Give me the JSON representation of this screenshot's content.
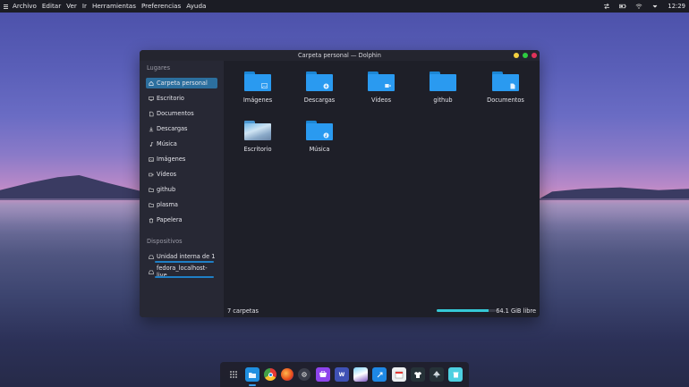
{
  "colors": {
    "accent": "#2c6f9e",
    "folder": "#2a9af0",
    "storage_fill": "#35c8d6",
    "close": "#e0325a",
    "maximize": "#2ecc40",
    "minimize": "#f4d03f"
  },
  "top_panel": {
    "menu": [
      "Archivo",
      "Editar",
      "Ver",
      "Ir",
      "Herramientas",
      "Preferencias",
      "Ayuda"
    ],
    "clock": "12:29",
    "tray_icons": [
      "transfer-icon",
      "battery-icon",
      "wifi-icon",
      "chevron-down-icon"
    ]
  },
  "window": {
    "title": "Carpeta personal — Dolphin",
    "sidebar": {
      "places_title": "Lugares",
      "places": [
        {
          "label": "Carpeta personal",
          "icon": "home-icon"
        },
        {
          "label": "Escritorio",
          "icon": "desktop-icon"
        },
        {
          "label": "Documentos",
          "icon": "documents-icon"
        },
        {
          "label": "Descargas",
          "icon": "download-icon"
        },
        {
          "label": "Música",
          "icon": "music-icon"
        },
        {
          "label": "Imágenes",
          "icon": "pictures-icon"
        },
        {
          "label": "Vídeos",
          "icon": "videos-icon"
        },
        {
          "label": "github",
          "icon": "folder-icon"
        },
        {
          "label": "plasma",
          "icon": "folder-icon"
        },
        {
          "label": "Papelera",
          "icon": "trash-icon"
        }
      ],
      "devices_title": "Dispositivos",
      "devices": [
        {
          "label": "Unidad interna de 1",
          "icon": "drive-icon"
        },
        {
          "label": "fedora_localhost-live",
          "icon": "drive-icon"
        }
      ]
    },
    "files": [
      {
        "label": "Imágenes",
        "badge": "pictures-icon"
      },
      {
        "label": "Descargas",
        "badge": "download-icon"
      },
      {
        "label": "Vídeos",
        "badge": "videos-icon"
      },
      {
        "label": "github",
        "badge": ""
      },
      {
        "label": "Documentos",
        "badge": "documents-icon"
      },
      {
        "label": "Escritorio",
        "badge": "desktop-icon"
      },
      {
        "label": "Música",
        "badge": "music-icon"
      }
    ],
    "status": {
      "count": "7 carpetas",
      "free": "64.1 GiB libre",
      "used_fraction": 0.88
    }
  },
  "dock": {
    "apps": [
      "app-grid-icon",
      "dolphin-icon",
      "chrome-icon",
      "firefox-icon",
      "settings-icon",
      "store-icon",
      "writer-icon",
      "image-viewer-icon",
      "terminal-icon",
      "calendar-icon",
      "shirt-icon",
      "inkscape-icon",
      "recycle-icon"
    ]
  }
}
